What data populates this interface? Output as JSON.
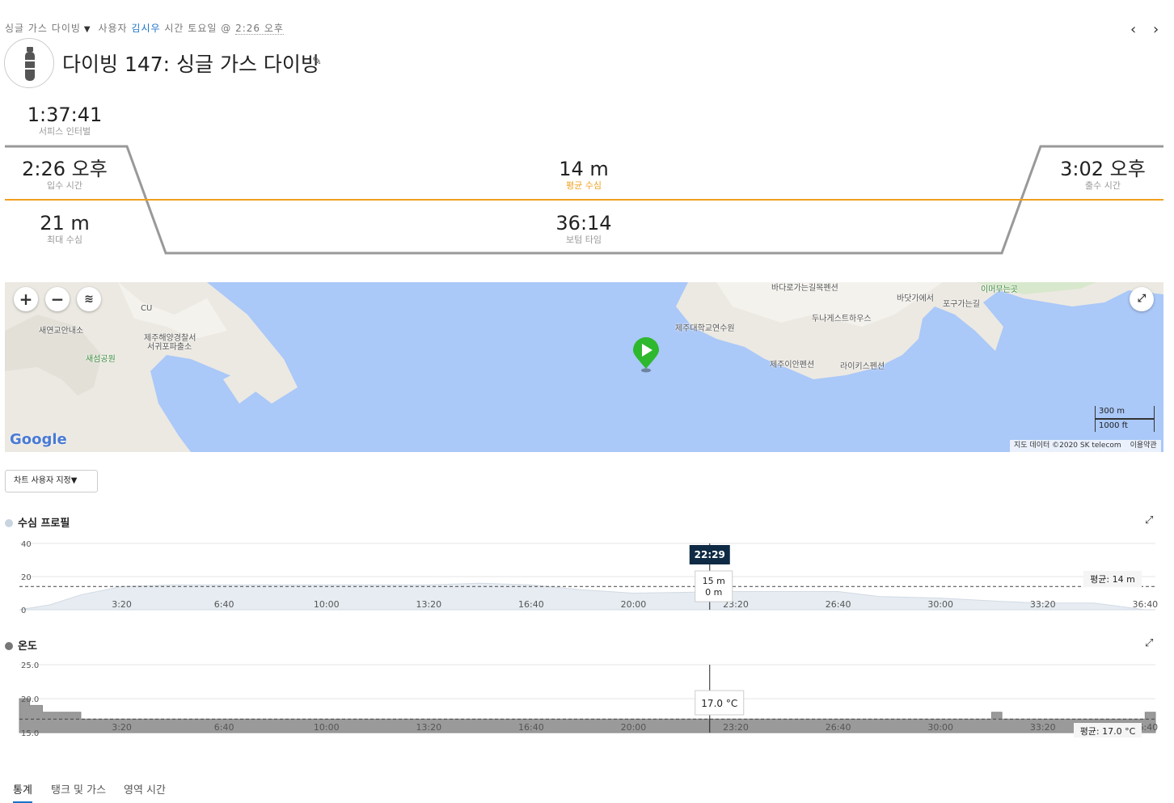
{
  "header": {
    "dive_type": "싱글 가스 다이빙",
    "user_prefix": "사용자",
    "user_name": "김시우",
    "time_prefix": "시간",
    "day": "토요일",
    "at": "@",
    "time": "2:26 오후",
    "title": "다이빙 147: 싱글 가스 다이빙"
  },
  "summary": {
    "surface_interval": {
      "value": "1:37:41",
      "label": "서피스 인터벌"
    },
    "entry_time": {
      "value": "2:26 오후",
      "label": "입수 시간"
    },
    "avg_depth": {
      "value": "14 m",
      "label": "평균 수심"
    },
    "exit_time": {
      "value": "3:02 오후",
      "label": "출수 시간"
    },
    "max_depth": {
      "value": "21 m",
      "label": "최대 수심"
    },
    "bottom_time": {
      "value": "36:14",
      "label": "보텀 타임"
    },
    "accent_color": "#f0a020"
  },
  "map": {
    "labels": [
      {
        "text": "새연교안내소",
        "cls": ""
      },
      {
        "text": "제주해양경찰서",
        "cls": ""
      },
      {
        "text": "서귀포파출소",
        "cls": ""
      },
      {
        "text": "새섬공원",
        "cls": "green"
      },
      {
        "text": "CU",
        "cls": ""
      },
      {
        "text": "제주대학교연수원",
        "cls": ""
      },
      {
        "text": "바다로가는길목펜션",
        "cls": ""
      },
      {
        "text": "두나게스트하우스",
        "cls": ""
      },
      {
        "text": "바닷가에서",
        "cls": ""
      },
      {
        "text": "포구가는길",
        "cls": ""
      },
      {
        "text": "이머무는곳",
        "cls": "green"
      },
      {
        "text": "제주이안펜션",
        "cls": ""
      },
      {
        "text": "라이키스펜션",
        "cls": ""
      }
    ],
    "google": "Google",
    "scale_m": "300 m",
    "scale_ft": "1000 ft",
    "attribution": "지도 데이터 ©2020 SK telecom",
    "terms": "이용약관",
    "zoom_in": "+",
    "zoom_out": "−"
  },
  "customize_label": "차트 사용자 지정",
  "depth_chart": {
    "title": "수심 프로필",
    "dot_color": "#c8d4e0",
    "y_ticks": [
      "0",
      "20",
      "40"
    ],
    "x_ticks": [
      "3:20",
      "6:40",
      "10:00",
      "13:20",
      "16:40",
      "20:00",
      "23:20",
      "26:40",
      "30:00",
      "33:20",
      "36:40"
    ],
    "cursor_time": "22:29",
    "tooltip_depth": "15 m",
    "tooltip_second": "0 m",
    "avg_label": "평균: 14 m"
  },
  "temp_chart": {
    "title": "온도",
    "dot_color": "#777777",
    "y_ticks": [
      "25.0",
      "20.0",
      "15.0"
    ],
    "x_ticks": [
      "3:20",
      "6:40",
      "10:00",
      "13:20",
      "16:40",
      "20:00",
      "23:20",
      "26:40",
      "30:00",
      "33:20",
      "36:40"
    ],
    "tooltip": "17.0 °C",
    "avg_label": "평균: 17.0 °C"
  },
  "tabs": [
    "통계",
    "탱크 및 가스",
    "영역 시간"
  ],
  "chart_data": [
    {
      "type": "area",
      "title": "수심 프로필",
      "x_unit": "min:sec",
      "x": [
        "0:00",
        "1:00",
        "2:00",
        "3:20",
        "5:00",
        "6:40",
        "10:00",
        "13:20",
        "15:00",
        "16:40",
        "18:20",
        "20:00",
        "23:20",
        "26:40",
        "28:00",
        "30:00",
        "32:00",
        "33:20",
        "35:00",
        "36:40",
        "37:00"
      ],
      "series": [
        {
          "values": [
            0,
            3,
            9,
            14,
            15,
            15,
            15,
            15,
            16,
            15,
            12,
            10,
            11,
            11,
            8,
            7,
            5,
            4,
            4,
            0,
            0
          ]
        }
      ],
      "ylim": [
        40,
        0
      ],
      "average": 14
    },
    {
      "type": "area",
      "title": "온도",
      "x_unit": "min:sec",
      "x": [
        "0:00",
        "0:20",
        "0:45",
        "2:00",
        "5:00",
        "30:00",
        "31:40",
        "32:00",
        "35:00",
        "36:40",
        "37:00"
      ],
      "series": [
        {
          "values": [
            20.0,
            19.0,
            18.0,
            17.0,
            17.0,
            17.0,
            18.0,
            17.0,
            17.0,
            18.0,
            18.0
          ]
        }
      ],
      "ylim": [
        15,
        25
      ],
      "average": 17.0
    }
  ]
}
